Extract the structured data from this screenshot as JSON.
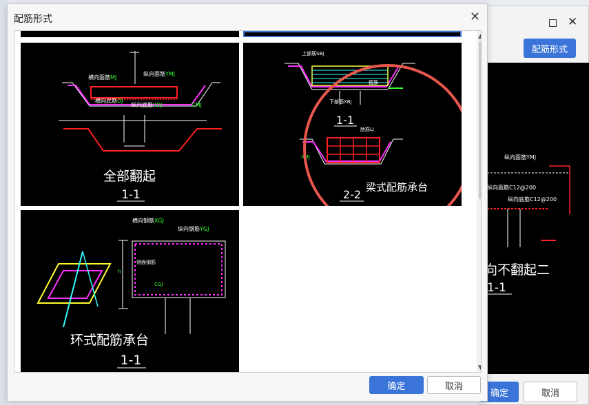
{
  "dialog": {
    "title": "配筋形式",
    "ok_label": "确定",
    "cancel_label": "取消"
  },
  "background_window": {
    "button_label": "配筋形式",
    "ok_label": "确定",
    "cancel_label": "取消",
    "cad_labels": {
      "ymj": "纵向面筋YMJ",
      "c12": "纵向面筋C12@200",
      "ydj": "纵向底筋C12@200",
      "caption": "向不翻起二",
      "section": "1-1"
    }
  },
  "thumbnails": [
    {
      "caption": "全部翻起",
      "section": "1-1",
      "labels": {
        "hmj": "横向面筋",
        "hmj_code": "MJ",
        "zmj": "纵向面筋",
        "zmj_code": "YMJ",
        "hdj": "横向底筋",
        "hdj_code": "DJ",
        "zdj": "纵向底筋",
        "zdj_code": "YDJ",
        "cmj": "CMJ"
      }
    },
    {
      "caption": "梁式配筋承台",
      "section_top": "1-1",
      "section_bottom": "2-2",
      "labels": {
        "sbj": "上部筋SBJ",
        "xbj": "下部筋XBJ",
        "lj": "肋筋LJ",
        "gj": "箍筋",
        "xmj": "XMJ"
      }
    },
    {
      "caption": "环式配筋承台",
      "section": "1-1",
      "labels": {
        "hxgj": "横向钢筋",
        "hxgj_code": "XGJ",
        "zxgj": "纵向钢筋",
        "zxgj_code": "YGJ",
        "cmgj": "侧面钢筋",
        "cmgj_code": "CGJ",
        "h": "h"
      }
    }
  ]
}
